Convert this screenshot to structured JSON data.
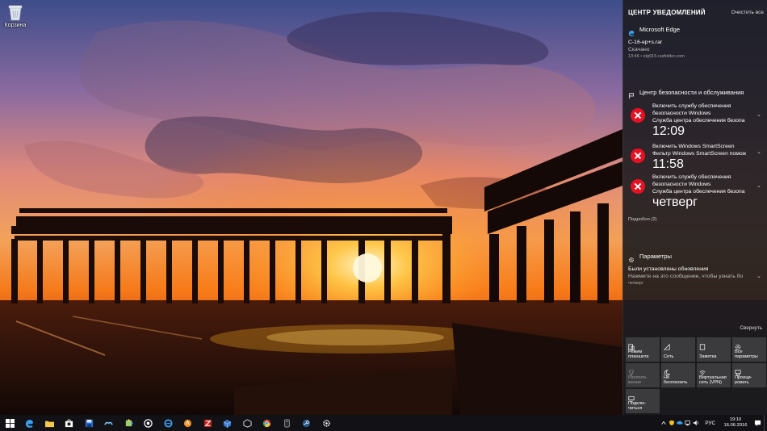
{
  "desktop": {
    "recycle_bin_label": "Корзина"
  },
  "action_center": {
    "title": "ЦЕНТР УВЕДОМЛЕНИЙ",
    "clear_all": "Очистить все",
    "edge_group": {
      "name": "Microsoft Edge",
      "icon": "edge-icon",
      "notification": {
        "title": "C-16-ep+s.rar",
        "status": "Скачано",
        "meta": "13:46 • stg915.rusfolder.com"
      }
    },
    "security_group": {
      "name": "Центр безопасности и обслуживания",
      "icon": "flag-icon",
      "items": [
        {
          "line1": "Включить службу обеспечения",
          "line2": "безопасности Windows",
          "line3": "Служба центра обеспечения безопа",
          "time": "12:09"
        },
        {
          "line1": "Включить Windows SmartScreen",
          "line2": "Фильтр Windows SmartScreen помож",
          "line3": "",
          "time": "11:58"
        },
        {
          "line1": "Включить службу обеспечения",
          "line2": "безопасности Windows",
          "line3": "Служба центра обеспечения безопа",
          "time": "четверг"
        }
      ],
      "more": "Подробно (2)"
    },
    "settings_group": {
      "name": "Параметры",
      "icon": "gear-icon",
      "notification": {
        "title": "Были установлены обновления",
        "body": "Нажмите на это сообщение, чтобы узнать бо",
        "time": "четверг"
      }
    },
    "collapse": "Свернуть",
    "quick_actions": [
      {
        "label": "Режим планшета",
        "icon": "tablet-mode-icon",
        "enabled": true
      },
      {
        "label": "Сеть",
        "icon": "network-icon",
        "enabled": true
      },
      {
        "label": "Заметка",
        "icon": "note-icon",
        "enabled": true
      },
      {
        "label": "Все параметры",
        "icon": "settings-icon",
        "enabled": true
      },
      {
        "label": "Располо-жение",
        "icon": "location-icon",
        "enabled": false
      },
      {
        "label": "Не беспокоить",
        "icon": "moon-icon",
        "enabled": true
      },
      {
        "label": "Виртуальная сеть (VPN)",
        "icon": "vpn-icon",
        "enabled": true
      },
      {
        "label": "Проеци-ровать",
        "icon": "project-icon",
        "enabled": true
      },
      {
        "label": "Подклю-читься",
        "icon": "connect-icon",
        "enabled": true
      }
    ]
  },
  "taskbar": {
    "apps": [
      "start-icon",
      "edge-icon",
      "file-explorer-icon",
      "store-icon",
      "save-disk-icon",
      "paw-app-icon",
      "puzzle-app-icon",
      "target-app-icon",
      "ie-icon",
      "avast-icon",
      "filezilla-icon",
      "virtualbox-icon",
      "unity-icon",
      "chrome-icon",
      "terminal-icon",
      "steam-icon",
      "settings-icon"
    ],
    "language": "РУС",
    "time": "19:10",
    "date": "16.06.2016",
    "colors": {
      "start": "#ffffff",
      "edge": "#3aa0f0",
      "accent": "#e81123"
    }
  }
}
